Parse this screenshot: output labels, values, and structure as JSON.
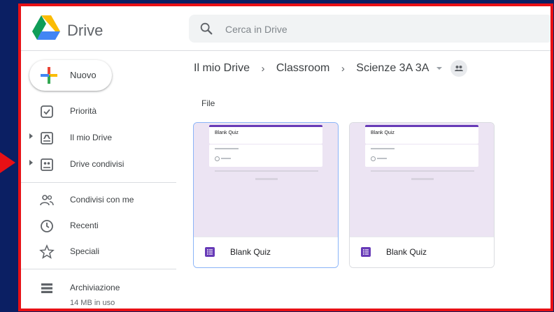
{
  "app": {
    "name": "Drive"
  },
  "search": {
    "placeholder": "Cerca in Drive"
  },
  "sidebar": {
    "new_label": "Nuovo",
    "items": [
      {
        "label": "Priorità",
        "icon": "priority-icon"
      },
      {
        "label": "Il mio Drive",
        "icon": "my-drive-icon"
      },
      {
        "label": "Drive condivisi",
        "icon": "shared-drives-icon"
      },
      {
        "label": "Condivisi con me",
        "icon": "shared-with-me-icon"
      },
      {
        "label": "Recenti",
        "icon": "clock-icon"
      },
      {
        "label": "Speciali",
        "icon": "star-icon"
      },
      {
        "label": "Archiviazione",
        "icon": "storage-icon"
      }
    ],
    "storage_used": "14 MB in uso"
  },
  "breadcrumb": [
    "Il mio Drive",
    "Classroom",
    "Scienze 3A 3A"
  ],
  "main": {
    "section_label": "File",
    "files": [
      {
        "name": "Blank Quiz",
        "thumbnail_title": "Blank Quiz",
        "icon": "google-forms-icon"
      },
      {
        "name": "Blank Quiz",
        "thumbnail_title": "Blank Quiz",
        "icon": "google-forms-icon"
      }
    ]
  },
  "colors": {
    "annotation_border": "#e81015",
    "background": "#0b1f63",
    "forms_purple": "#673ab7",
    "selection": "#8ab4f8"
  }
}
